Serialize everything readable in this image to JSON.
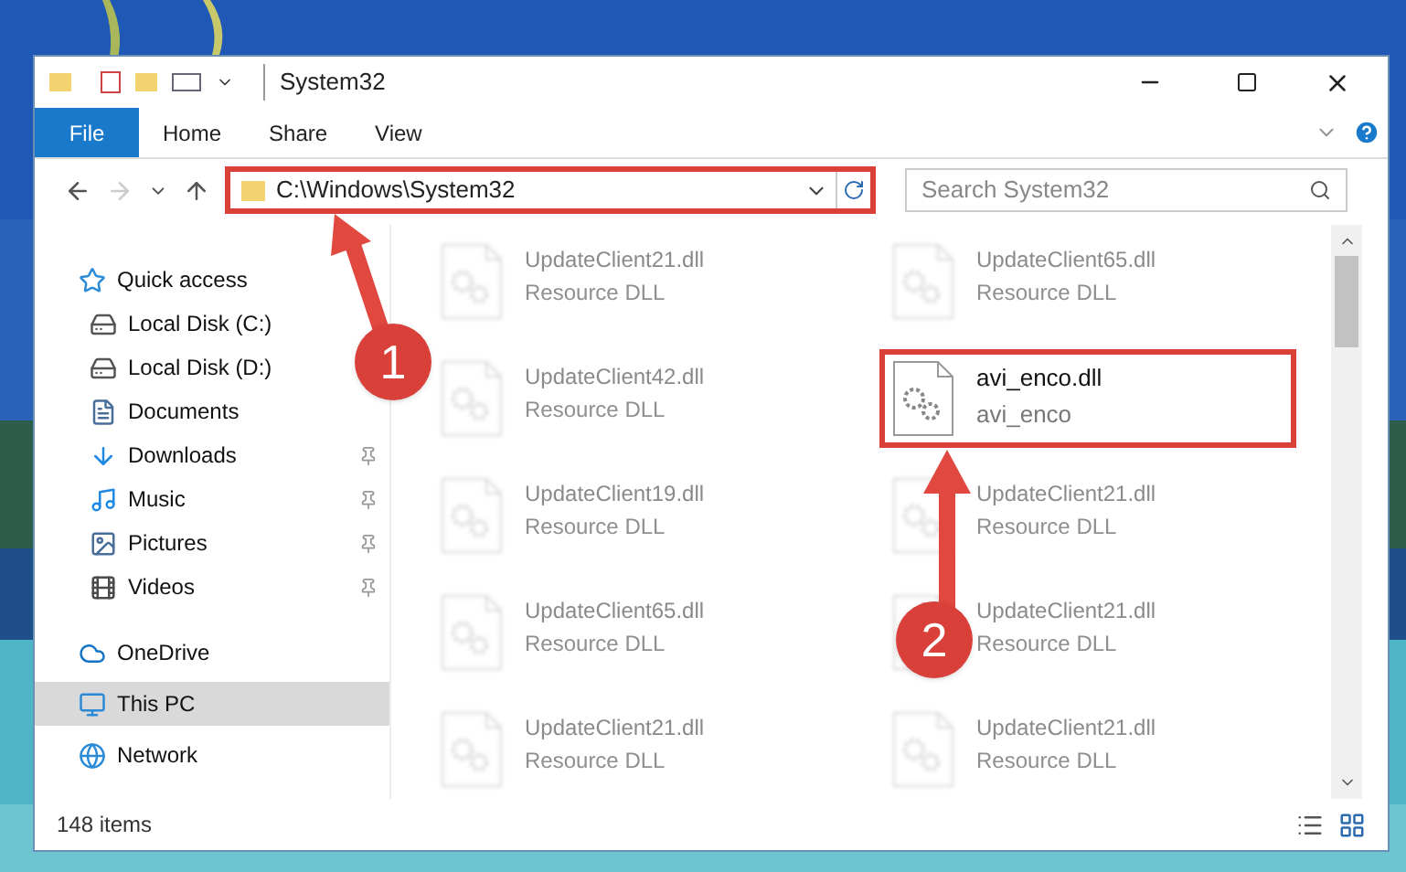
{
  "window": {
    "title": "System32"
  },
  "ribbon": {
    "tabs": [
      {
        "label": "File",
        "selected": true
      },
      {
        "label": "Home",
        "selected": false
      },
      {
        "label": "Share",
        "selected": false
      },
      {
        "label": "View",
        "selected": false
      }
    ]
  },
  "address": {
    "path": "C:\\Windows\\System32",
    "highlighted": true
  },
  "search": {
    "placeholder": "Search System32"
  },
  "sidebar": {
    "items": [
      {
        "label": "Quick access",
        "kind": "group",
        "pinned": false,
        "selected": false
      },
      {
        "label": "Local Disk (C:)",
        "kind": "location",
        "pinned": false,
        "selected": false
      },
      {
        "label": "Local Disk (D:)",
        "kind": "location",
        "pinned": false,
        "selected": false
      },
      {
        "label": "Documents",
        "kind": "location",
        "pinned": false,
        "selected": false
      },
      {
        "label": "Downloads",
        "kind": "location",
        "pinned": true,
        "selected": false
      },
      {
        "label": "Music",
        "kind": "location",
        "pinned": true,
        "selected": false
      },
      {
        "label": "Pictures",
        "kind": "location",
        "pinned": true,
        "selected": false
      },
      {
        "label": "Videos",
        "kind": "location",
        "pinned": true,
        "selected": false
      },
      {
        "label": "OneDrive",
        "kind": "group",
        "pinned": false,
        "selected": false
      },
      {
        "label": "This PC",
        "kind": "group",
        "pinned": false,
        "selected": true
      },
      {
        "label": "Network",
        "kind": "group",
        "pinned": false,
        "selected": false
      }
    ]
  },
  "files": [
    {
      "name": "UpdateClient21.dll",
      "type": "Resource DLL",
      "kind": "blurred",
      "highlighted": false
    },
    {
      "name": "UpdateClient65.dll",
      "type": "Resource DLL",
      "kind": "blurred",
      "highlighted": false
    },
    {
      "name": "UpdateClient42.dll",
      "type": "Resource DLL",
      "kind": "blurred",
      "highlighted": false
    },
    {
      "name": "avi_enco.dll",
      "type": "avi_enco",
      "kind": "clear",
      "highlighted": true
    },
    {
      "name": "UpdateClient19.dll",
      "type": "Resource DLL",
      "kind": "blurred",
      "highlighted": false
    },
    {
      "name": "UpdateClient21.dll",
      "type": "Resource DLL",
      "kind": "blurred",
      "highlighted": false
    },
    {
      "name": "UpdateClient65.dll",
      "type": "Resource DLL",
      "kind": "blurred",
      "highlighted": false
    },
    {
      "name": "UpdateClient21.dll",
      "type": "Resource DLL",
      "kind": "blurred",
      "highlighted": false
    },
    {
      "name": "UpdateClient21.dll",
      "type": "Resource DLL",
      "kind": "blurred",
      "highlighted": false
    },
    {
      "name": "UpdateClient21.dll",
      "type": "Resource DLL",
      "kind": "blurred",
      "highlighted": false
    }
  ],
  "annotations": [
    {
      "label": "1"
    },
    {
      "label": "2"
    }
  ],
  "status_bar": {
    "count": "148 items"
  }
}
